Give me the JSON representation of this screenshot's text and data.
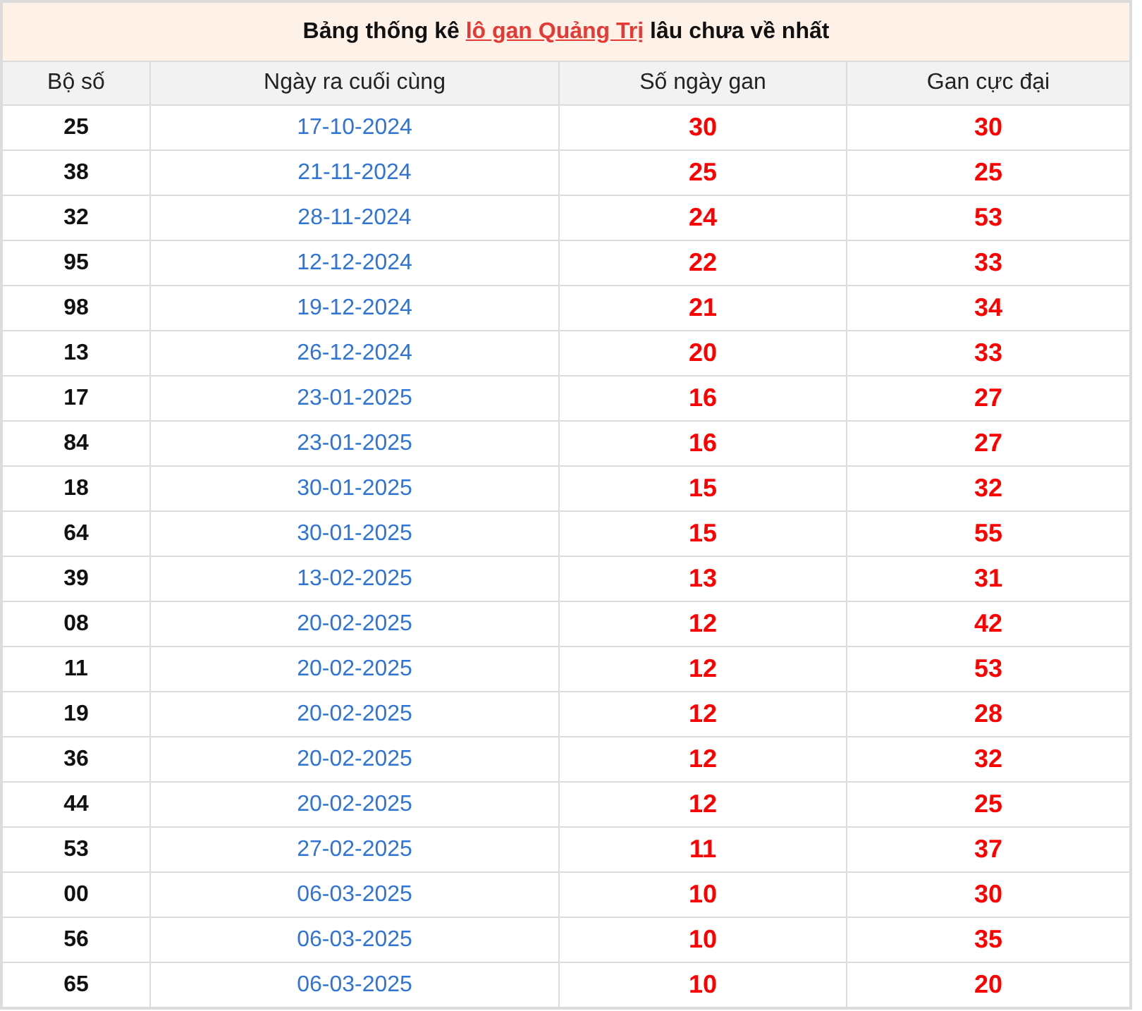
{
  "title": {
    "before": "Bảng thống kê",
    "link": "lô gan Quảng Trị",
    "after": "lâu chưa về nhất"
  },
  "columns": [
    "Bộ số",
    "Ngày ra cuối cùng",
    "Số ngày gan",
    "Gan cực đại"
  ],
  "rows": [
    [
      "25",
      "17-10-2024",
      "30",
      "30"
    ],
    [
      "38",
      "21-11-2024",
      "25",
      "25"
    ],
    [
      "32",
      "28-11-2024",
      "24",
      "53"
    ],
    [
      "95",
      "12-12-2024",
      "22",
      "33"
    ],
    [
      "98",
      "19-12-2024",
      "21",
      "34"
    ],
    [
      "13",
      "26-12-2024",
      "20",
      "33"
    ],
    [
      "17",
      "23-01-2025",
      "16",
      "27"
    ],
    [
      "84",
      "23-01-2025",
      "16",
      "27"
    ],
    [
      "18",
      "30-01-2025",
      "15",
      "32"
    ],
    [
      "64",
      "30-01-2025",
      "15",
      "55"
    ],
    [
      "39",
      "13-02-2025",
      "13",
      "31"
    ],
    [
      "08",
      "20-02-2025",
      "12",
      "42"
    ],
    [
      "11",
      "20-02-2025",
      "12",
      "53"
    ],
    [
      "19",
      "20-02-2025",
      "12",
      "28"
    ],
    [
      "36",
      "20-02-2025",
      "12",
      "32"
    ],
    [
      "44",
      "20-02-2025",
      "12",
      "25"
    ],
    [
      "53",
      "27-02-2025",
      "11",
      "37"
    ],
    [
      "00",
      "06-03-2025",
      "10",
      "30"
    ],
    [
      "56",
      "06-03-2025",
      "10",
      "35"
    ],
    [
      "65",
      "06-03-2025",
      "10",
      "20"
    ]
  ]
}
